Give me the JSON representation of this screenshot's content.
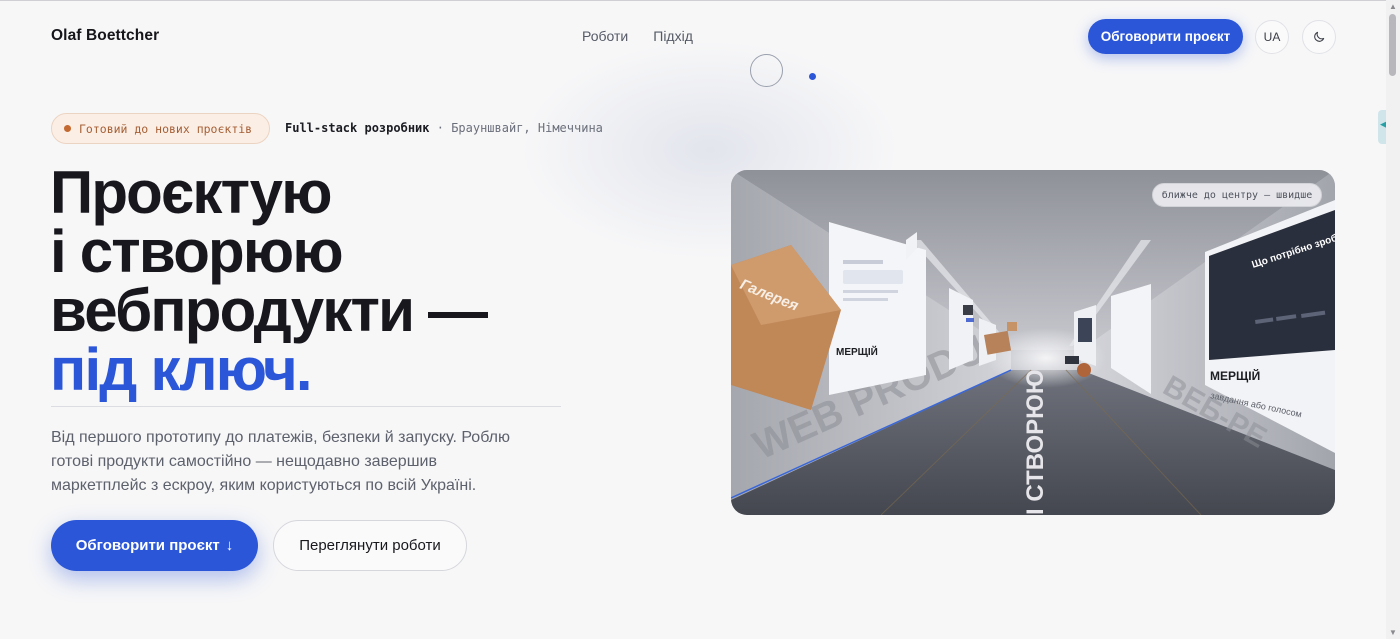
{
  "header": {
    "brand": "Olaf Boettcher",
    "nav": [
      "Роботи",
      "Підхід"
    ],
    "cta": "Обговорити проєкт",
    "lang": "UA",
    "theme_icon": "moon-icon"
  },
  "hero": {
    "status": "Готовий до нових проєктів",
    "role_strong": "Full-stack розробник",
    "role_sep": " · ",
    "location": "Брауншвайг, Німеччина",
    "headline_lines": [
      "Проєктую",
      "і створюю",
      "вебпродукти —"
    ],
    "headline_accent": "під ключ.",
    "lead": "Від першого прототипу до платежів, безпеки й запуску. Роблю готові продукти самостійно — нещодавно завершив маркетплейс з ескроу, яким користуються по всій Україні.",
    "primary_button": "Обговорити проєкт",
    "primary_icon": "↓",
    "secondary_button": "Переглянути роботи"
  },
  "scene": {
    "hint": "ближче до центру — швидше",
    "box_label": "Галерея",
    "floor_text": "І СТВОРЮЮ",
    "wall_text_left": "WEB PRODU",
    "wall_text_right": "ВЕБ-РЕ",
    "card_left_title": "МЕРЩІЙ",
    "card_right_title": "МЕРЩІЙ",
    "card_right_heading": "Що потрібно зробити",
    "card_right_sub": "завдання або голосом"
  },
  "colors": {
    "accent": "#2b56d8",
    "status_bg": "#fbeee5",
    "status_dot": "#c4692f",
    "text": "#17171d"
  }
}
